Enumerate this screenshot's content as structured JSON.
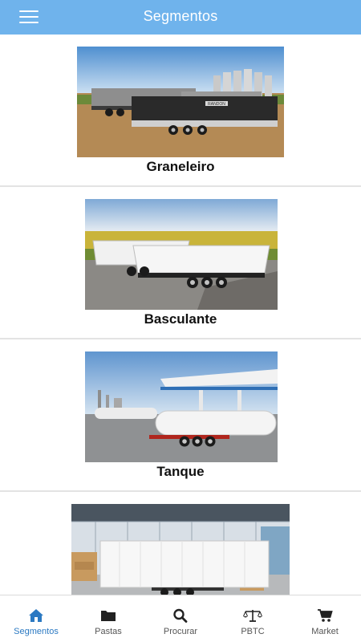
{
  "header": {
    "title": "Segmentos",
    "menu_icon": "hamburger-menu-icon"
  },
  "segments": [
    {
      "label": "Graneleiro",
      "image": "grain-trailer-photo",
      "trailer_brand": "RANDON"
    },
    {
      "label": "Basculante",
      "image": "dump-trailer-photo"
    },
    {
      "label": "Tanque",
      "image": "tank-trailer-photo"
    },
    {
      "label": "",
      "image": "box-trailer-photo"
    }
  ],
  "tabs": [
    {
      "label": "Segmentos",
      "icon": "home-icon",
      "active": true
    },
    {
      "label": "Pastas",
      "icon": "folder-icon",
      "active": false
    },
    {
      "label": "Procurar",
      "icon": "search-icon",
      "active": false
    },
    {
      "label": "PBTC",
      "icon": "scale-icon",
      "active": false
    },
    {
      "label": "Market",
      "icon": "cart-icon",
      "active": false
    }
  ],
  "colors": {
    "header_bg": "#6fb3ec",
    "tab_active": "#2b79c2",
    "tab_inactive": "#555555"
  }
}
